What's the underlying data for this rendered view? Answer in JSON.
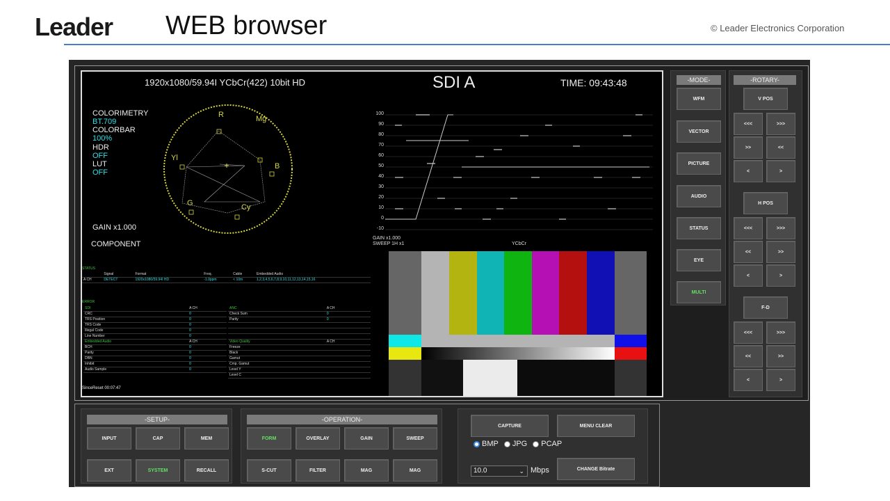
{
  "header": {
    "logo": "Leader",
    "title": "WEB browser",
    "copyright": "© Leader Electronics Corporation"
  },
  "monitor": {
    "format": "1920x1080/59.94I YCbCr(422) 10bit HD",
    "input": "SDI A",
    "time": "TIME: 09:43:48",
    "info": {
      "l1": "COLORIMETRY",
      "v1": "BT.709",
      "l2": "COLORBAR",
      "v2": "100%",
      "l3": "HDR",
      "v3": "OFF",
      "l4": "LUT",
      "v4": "OFF"
    },
    "vec_labels": {
      "r": "R",
      "mg": "Mg",
      "yl": "Yl",
      "b": "B",
      "g": "G",
      "cy": "Cy"
    },
    "gain": "GAIN x1.000",
    "component": "COMPONENT",
    "wfm_ticks": [
      "100",
      "90",
      "80",
      "70",
      "60",
      "50",
      "40",
      "30",
      "20",
      "10",
      "0",
      "-10"
    ],
    "wfm_gain": "GAIN x1.000",
    "wfm_sweep": "SWEEP 1H x1",
    "wfm_mode": "YCbCr",
    "status": {
      "title": "STATUS",
      "headers": [
        "",
        "Signal",
        "Format",
        "Freq.",
        "Cable",
        "Embedded Audio"
      ],
      "row": [
        "A CH",
        "DETECT",
        "1920x1080/59.94I HD",
        "-1.0ppm",
        "< 10m",
        "1,2,3,4,5,6,7,8,9,10,11,12,13,14,15,16"
      ]
    },
    "error": {
      "title": "ERROR",
      "sdi": "SDI",
      "anc": "ANC",
      "ach": "A CH",
      "sdi_rows": [
        [
          "CRC",
          "0"
        ],
        [
          "TRS Position",
          "0"
        ],
        [
          "TRS Code",
          "0"
        ],
        [
          "Illegal Code",
          "0"
        ],
        [
          "Line Number",
          "0"
        ]
      ],
      "anc_rows": [
        [
          "Check Sum",
          "0"
        ],
        [
          "Parity",
          "0"
        ]
      ],
      "audio": "Embedded Audio",
      "vq": "Video Quality",
      "audio_rows": [
        [
          "BCH",
          "0"
        ],
        [
          "Parity",
          "0"
        ],
        [
          "DBN",
          "0"
        ],
        [
          "Inhibit",
          "0"
        ],
        [
          "Audio Sample",
          "0"
        ]
      ],
      "vq_rows": [
        "Freeze",
        "Black",
        "Gamut",
        "Cmp. Gamut",
        "Level Y",
        "Level C"
      ],
      "since": "SinceReset 00:07:47"
    }
  },
  "mode": {
    "title": "-MODE-",
    "items": [
      "WFM",
      "VECTOR",
      "PICTURE",
      "AUDIO",
      "STATUS",
      "EYE",
      "MULTI"
    ]
  },
  "rotary": {
    "title": "-ROTARY-",
    "vpos": "V POS",
    "hpos": "H POS",
    "fd": "F-D",
    "b3l": "<<<",
    "b3r": ">>>",
    "b2l": "<<",
    "b2r": ">>",
    "b2rr": ">>",
    "b2ll": "<<",
    "b1l": "<",
    "b1r": ">"
  },
  "setup": {
    "title": "-SETUP-",
    "items": [
      "INPUT",
      "CAP",
      "MEM",
      "EXT",
      "SYSTEM",
      "RECALL"
    ]
  },
  "operation": {
    "title": "-OPERATION-",
    "items": [
      "FORM",
      "OVERLAY",
      "GAIN",
      "SWEEP",
      "S-CUT",
      "FILTER",
      "MAG",
      "MAG"
    ]
  },
  "capture": {
    "capture": "CAPTURE",
    "menu_clear": "MENU CLEAR",
    "formats": [
      "BMP",
      "JPG",
      "PCAP"
    ],
    "selected_format": "BMP",
    "bitrate": "10.0",
    "unit": "Mbps",
    "change": "CHANGE Bitrate"
  },
  "colors": {
    "accent_green": "#62e062",
    "cyan": "#2ee0e8",
    "rule": "#4a7ec4"
  }
}
